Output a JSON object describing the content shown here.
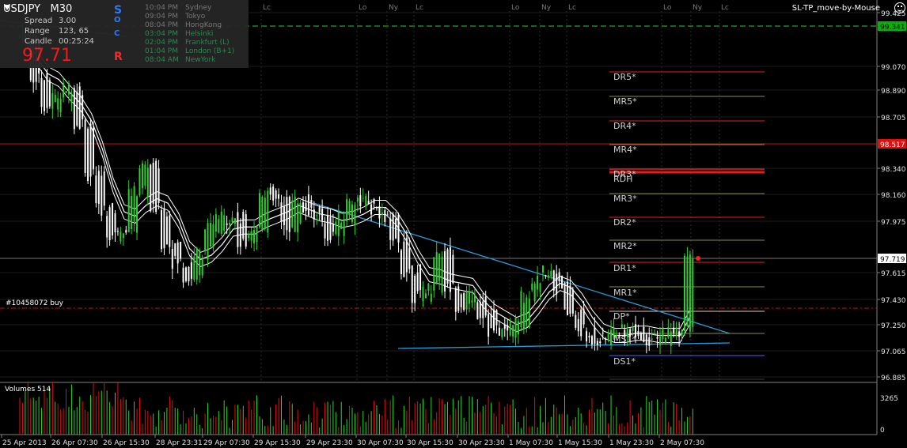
{
  "header": {
    "symbol": "USDJPY",
    "timeframe": "M30",
    "symbol_line": "USDJPY   M30",
    "spread_label": "Spread",
    "spread_value": "3.00",
    "range_label": "Range",
    "range_value": "123, 65",
    "candle_label": "Candle",
    "candle_value": "00:25:24",
    "bid": "97.71",
    "socr": [
      "S",
      "O",
      "C",
      "R"
    ],
    "socr_colors": [
      "#2f7fff",
      "#2f7fff",
      "#2f7fff",
      "#ff2a2a"
    ],
    "sessions": [
      {
        "time": "10:04 PM",
        "name": "Sydney",
        "color": "#7a7a7a"
      },
      {
        "time": "09:04 PM",
        "name": "Tokyo",
        "color": "#7a7a7a"
      },
      {
        "time": "08:04 PM",
        "name": "HongKong",
        "color": "#7a7a7a"
      },
      {
        "time": "03:04 PM",
        "name": "Helsinki",
        "color": "#2e8b57"
      },
      {
        "time": "02:04 PM",
        "name": "Frankfurt (L)",
        "color": "#2e8b57"
      },
      {
        "time": "01:04 PM",
        "name": "London (B+1)",
        "color": "#2e8b57"
      },
      {
        "time": "08:04 AM",
        "name": "NewYork",
        "color": "#2e8b57"
      }
    ]
  },
  "indicator_title": "SL-TP_move-by-Mouse",
  "session_markers": [
    {
      "label": "Lc",
      "color": "#7a7a7a"
    },
    {
      "label": "Lo",
      "color": "#7a7a7a"
    },
    {
      "label": "Ny",
      "color": "#7a7a7a"
    },
    {
      "label": "Lc",
      "color": "#7a7a7a"
    },
    {
      "label": "Lo",
      "color": "#7a7a7a"
    },
    {
      "label": "Ny",
      "color": "#7a7a7a"
    },
    {
      "label": "Lc",
      "color": "#7a7a7a"
    },
    {
      "label": "Lo",
      "color": "#7a7a7a"
    },
    {
      "label": "Ny",
      "color": "#7a7a7a"
    },
    {
      "label": "Lc",
      "color": "#7a7a7a"
    }
  ],
  "price_scale": [
    "99.425",
    "99.070",
    "98.890",
    "98.705",
    "98.340",
    "98.160",
    "97.975",
    "97.615",
    "97.430",
    "97.250",
    "97.065",
    "96.885"
  ],
  "price_tags": [
    {
      "label": "99.341",
      "bg": "#00b400",
      "fg": "#000000"
    },
    {
      "label": "98.517",
      "bg": "#e01010",
      "fg": "#ffffff"
    },
    {
      "label": "97.719",
      "bg": "#ffffff",
      "fg": "#000000"
    }
  ],
  "pivot_labels": [
    "DR5*",
    "MR5*",
    "DR4*",
    "MR4*",
    "DR3*",
    "RDH",
    "MR3*",
    "DR2*",
    "MR2*",
    "DR1*",
    "MR1*",
    "DP*",
    "MS1*",
    "DS1*"
  ],
  "order_label": "#10458072 buy",
  "volume": {
    "title": "Volumes 514",
    "scale_max": "3265",
    "scale_min": "0"
  },
  "time_axis": [
    "25 Apr 2013",
    "26 Apr 07:30",
    "26 Apr 15:30",
    "28 Apr 23:31",
    "29 Apr 07:30",
    "29 Apr 15:30",
    "29 Apr 23:30",
    "30 Apr 07:30",
    "30 Apr 15:30",
    "30 Apr 23:30",
    "1 May 07:30",
    "1 May 15:30",
    "1 May 23:30",
    "2 May 07:30"
  ],
  "colors": {
    "bull": "#33cc33",
    "bear": "#ffffff",
    "grid": "#3a3a3a",
    "axis": "#808080"
  },
  "chart_data": {
    "type": "candlestick",
    "title": "USDJPY, M30",
    "ylim": [
      96.8,
      99.5
    ],
    "close_approx": [
      99.0,
      98.75,
      98.6,
      98.65,
      98.7,
      98.5,
      98.2,
      98.0,
      97.85,
      97.9,
      98.1,
      98.25,
      98.0,
      97.8,
      97.7,
      97.6,
      97.75,
      97.9,
      97.95,
      97.95,
      97.8,
      97.9,
      98.1,
      98.05,
      97.9,
      98.05,
      98.0,
      97.95,
      97.85,
      97.95,
      98.05,
      98.05,
      98.0,
      97.95,
      97.8,
      97.65,
      97.5,
      97.55,
      97.75,
      97.55,
      97.45,
      97.5,
      97.4,
      97.3,
      97.3,
      97.35,
      97.5,
      97.6,
      97.65,
      97.55,
      97.4,
      97.3,
      97.25,
      97.25,
      97.3,
      97.3,
      97.3,
      97.25,
      97.25,
      97.3,
      97.3,
      97.72
    ]
  }
}
